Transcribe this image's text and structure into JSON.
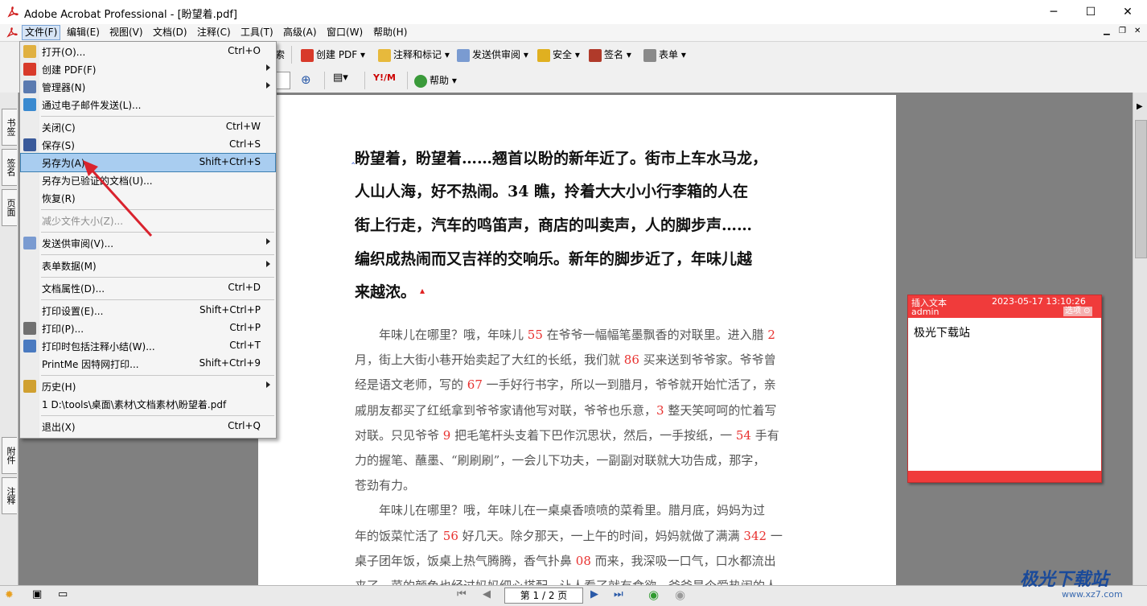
{
  "window": {
    "title": "Adobe Acrobat Professional - [盼望着.pdf]",
    "min": "─",
    "max": "☐",
    "close": "✕"
  },
  "menubar": [
    "文件(F)",
    "编辑(E)",
    "视图(V)",
    "文档(D)",
    "注释(C)",
    "工具(T)",
    "高级(A)",
    "窗口(W)",
    "帮助(H)"
  ],
  "toolbar1": {
    "search": "索",
    "create_pdf": "创建 PDF",
    "comment": "注释和标记",
    "send_review": "发送供审阅",
    "security": "安全",
    "sign": "签名",
    "forms": "表单"
  },
  "toolbar2": {
    "help": "帮助"
  },
  "left_tabs": [
    "书签",
    "签名",
    "页面",
    "附件",
    "注释"
  ],
  "file_menu": [
    {
      "label": "打开(O)...",
      "shortcut": "Ctrl+O",
      "icon": "folder-icon"
    },
    {
      "label": "创建 PDF(F)",
      "submenu": true,
      "icon": "pdf-icon"
    },
    {
      "label": "管理器(N)",
      "submenu": true,
      "icon": "organizer-icon"
    },
    {
      "label": "通过电子邮件发送(L)...",
      "icon": "email-icon"
    },
    {
      "label": "关闭(C)",
      "shortcut": "Ctrl+W"
    },
    {
      "label": "保存(S)",
      "shortcut": "Ctrl+S",
      "icon": "save-icon"
    },
    {
      "label": "另存为(A)...",
      "shortcut": "Shift+Ctrl+S",
      "highlighted": true
    },
    {
      "label": "另存为已验证的文档(U)..."
    },
    {
      "label": "恢复(R)"
    },
    {
      "label": "减少文件大小(Z)...",
      "disabled": true
    },
    {
      "label": "发送供审阅(V)...",
      "submenu": true,
      "icon": "review-icon"
    },
    {
      "label": "表单数据(M)",
      "submenu": true
    },
    {
      "label": "文档属性(D)...",
      "shortcut": "Ctrl+D"
    },
    {
      "label": "打印设置(E)...",
      "shortcut": "Shift+Ctrl+P"
    },
    {
      "label": "打印(P)...",
      "shortcut": "Ctrl+P",
      "icon": "printer-icon"
    },
    {
      "label": "打印时包括注释小结(W)...",
      "shortcut": "Ctrl+T",
      "icon": "comment-print-icon"
    },
    {
      "label": "PrintMe 因特网打印...",
      "shortcut": "Shift+Ctrl+9"
    },
    {
      "label": "历史(H)",
      "submenu": true,
      "icon": "history-icon"
    },
    {
      "label": "1 D:\\tools\\桌面\\素材\\文档素材\\盼望着.pdf"
    },
    {
      "label": "退出(X)",
      "shortcut": "Ctrl+Q"
    }
  ],
  "document": {
    "heading_lines": [
      "盼望着，盼望着……翘首以盼的新年近了。街市上车水马龙，",
      "人山人海，好不热闹。34 瞧，拎着大大小小行李箱的人在",
      "街上行走，汽车的鸣笛声，商店的叫卖声，人的脚步声……",
      "编织成热闹而又吉祥的交响乐。新年的脚步近了，年味儿越",
      "来越浓。"
    ],
    "para_lines": [
      [
        "　　年味儿在哪里？哦，年味儿 ",
        "55",
        " 在爷爷一幅幅笔墨飘香的对联里。进入腊 ",
        "2"
      ],
      [
        "月，街上大街小巷开始卖起了大红的长纸，我们就 ",
        "86",
        " 买来送到爷爷家。爷爷曾",
        ""
      ],
      [
        "经是语文老师，写的 ",
        "67",
        " 一手好行书字，所以一到腊月，爷爷就开始忙活了，亲",
        ""
      ],
      [
        "戚朋友都买了红纸拿到爷爷家请他写对联，爷爷也乐意，",
        "3",
        " 整天笑呵呵的忙着写",
        ""
      ],
      [
        "对联。只见爷爷 ",
        "9",
        " 把毛笔杆头支着下巴作沉思状，然后，一手按纸，一 ",
        "54",
        " 手有"
      ],
      [
        "力的握笔、蘸墨、“刷刷刷”，一会儿下功夫，一副副对联就大功告成，那字，",
        "",
        "",
        ""
      ],
      [
        "苍劲有力。",
        "",
        "",
        ""
      ],
      [
        "　　年味儿在哪里？哦，年味儿在一桌桌香喷喷的菜肴里。腊月底，妈妈为过",
        "",
        "",
        ""
      ],
      [
        "年的饭菜忙活了 ",
        "56",
        " 好几天。除夕那天，一上午的时间，妈妈就做了满满 ",
        "342",
        " 一"
      ],
      [
        "桌子团年饭，饭桌上热气腾腾，香气扑鼻 ",
        "08",
        " 而来，我深吸一口气，口水都流出",
        ""
      ],
      [
        "来了。菜的颜色也经过妈妈细心搭配，让人看了就有食欲。爸爸是个爱热闹的人",
        "",
        "",
        ""
      ]
    ]
  },
  "note": {
    "type": "插入文本",
    "datetime": "2023-05-17 13:10:26",
    "author": "admin",
    "options": "选项",
    "body": "极光下载站"
  },
  "statusbar": {
    "page": "第 1 / 2 页"
  },
  "watermark": {
    "text": "极光下载站",
    "url": "www.xz7.com"
  },
  "colors": {
    "highlight": "#a9cdf0",
    "note": "#f03b3b",
    "arrow": "#d9232e"
  }
}
